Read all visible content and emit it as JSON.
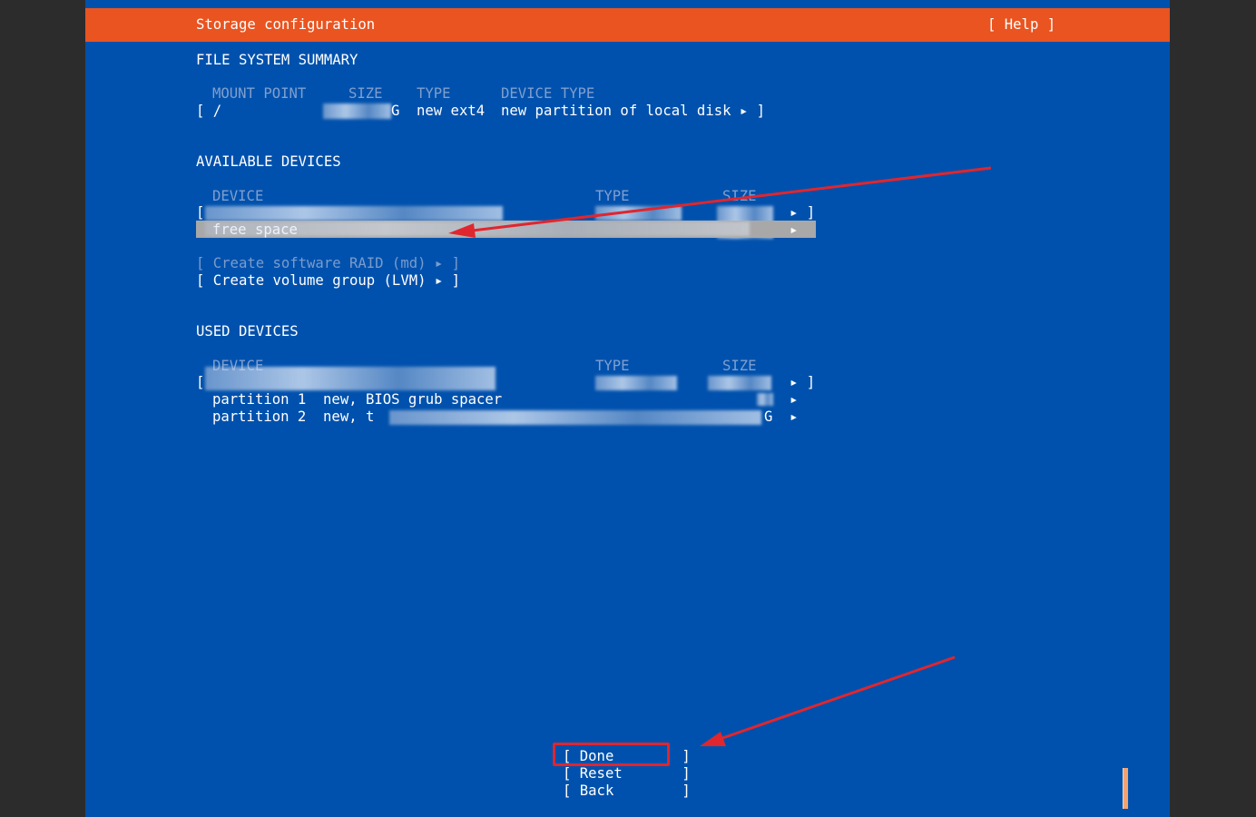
{
  "header": {
    "title": "Storage configuration",
    "help_label": "[ Help ]"
  },
  "fs_summary": {
    "section_title": "FILE SYSTEM SUMMARY",
    "col_mount": "MOUNT POINT",
    "col_size": "SIZE",
    "col_type": "TYPE",
    "col_device_type": "DEVICE TYPE",
    "row_open": "[ /",
    "row_size_suffix": "G",
    "row_type": "new ext4",
    "row_device_type": "new partition of local disk ▸ ]"
  },
  "available_devices": {
    "section_title": "AVAILABLE DEVICES",
    "col_device": "DEVICE",
    "col_type": "TYPE",
    "col_size": "SIZE",
    "disk_row_open": "[",
    "disk_row_close": "▸ ]",
    "free_space_label": "free space",
    "free_space_arrow": "▸",
    "create_raid": "[ Create software RAID (md) ▸ ]",
    "create_lvm": "[ Create volume group (LVM) ▸ ]"
  },
  "used_devices": {
    "section_title": "USED DEVICES",
    "col_device": "DEVICE",
    "col_type": "TYPE",
    "col_size": "SIZE",
    "disk_row_open": "[",
    "disk_row_close": "▸ ]",
    "partition1": "partition 1  new, BIOS grub spacer",
    "partition1_arrow": "▸",
    "partition2": "partition 2  new, t",
    "partition2_size_suffix": "G",
    "partition2_arrow": "▸"
  },
  "buttons": {
    "done": "[ Done        ]",
    "reset": "[ Reset       ]",
    "back": "[ Back        ]"
  },
  "colors": {
    "background": "#0051ad",
    "header": "#e95420",
    "annotation": "#e0262e"
  }
}
